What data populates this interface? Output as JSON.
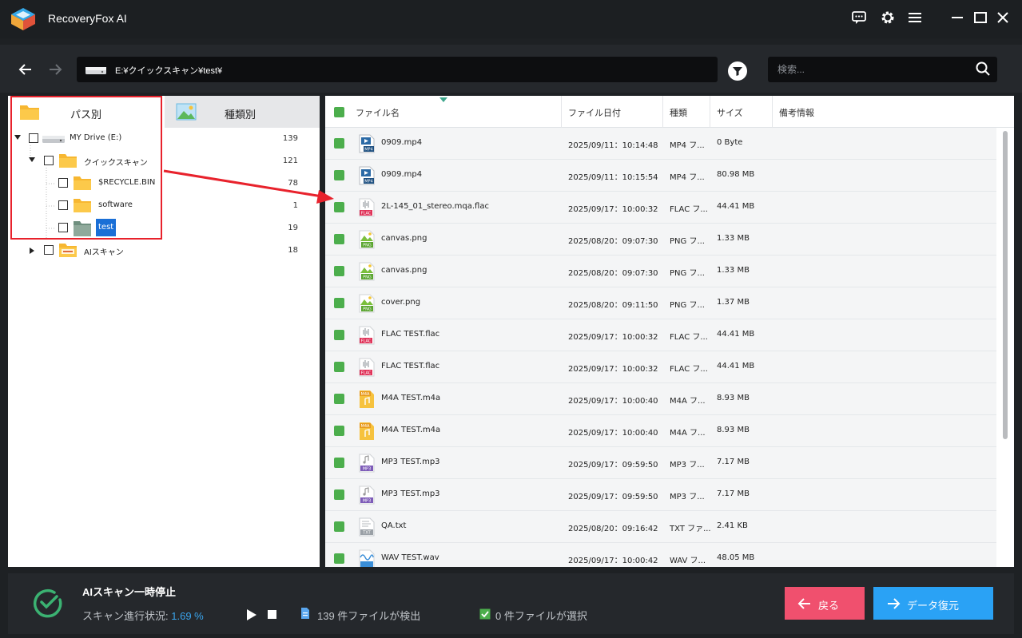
{
  "app": {
    "title": "RecoveryFox AI"
  },
  "address": {
    "path": "E:¥クイックスキャン¥test¥",
    "search_placeholder": "検索..."
  },
  "left": {
    "tabs": [
      {
        "label": "パス別"
      },
      {
        "label": "種類別"
      }
    ],
    "tree": [
      {
        "label": "MY Drive (E:)",
        "count": "139"
      },
      {
        "label": "クイックスキャン",
        "count": "121"
      },
      {
        "label": "$RECYCLE.BIN",
        "count": "78"
      },
      {
        "label": "software",
        "count": "1"
      },
      {
        "label": "test",
        "count": "19"
      },
      {
        "label": "AIスキャン",
        "count": "18"
      }
    ]
  },
  "table": {
    "headers": {
      "name": "ファイル名",
      "date": "ファイル日付",
      "type": "種類",
      "size": "サイズ",
      "note": "備考情報"
    },
    "rows": [
      {
        "name": "0909.mp4",
        "date": "2025/09/11：10:14:48",
        "type": "MP4 フ...",
        "size": "0 Byte",
        "icon": "mp4-icon"
      },
      {
        "name": "0909.mp4",
        "date": "2025/09/11：10:15:54",
        "type": "MP4 フ...",
        "size": "80.98 MB",
        "icon": "mp4-icon"
      },
      {
        "name": "2L-145_01_stereo.mqa.flac",
        "date": "2025/09/17：10:00:32",
        "type": "FLAC フ...",
        "size": "44.41 MB",
        "icon": "flac-icon"
      },
      {
        "name": "canvas.png",
        "date": "2025/08/20：09:07:30",
        "type": "PNG フ...",
        "size": "1.33 MB",
        "icon": "png-icon"
      },
      {
        "name": "canvas.png",
        "date": "2025/08/20：09:07:30",
        "type": "PNG フ...",
        "size": "1.33 MB",
        "icon": "png-icon"
      },
      {
        "name": "cover.png",
        "date": "2025/08/20：09:11:50",
        "type": "PNG フ...",
        "size": "1.37 MB",
        "icon": "png-icon"
      },
      {
        "name": "FLAC TEST.flac",
        "date": "2025/09/17：10:00:32",
        "type": "FLAC フ...",
        "size": "44.41 MB",
        "icon": "flac-icon"
      },
      {
        "name": "FLAC TEST.flac",
        "date": "2025/09/17：10:00:32",
        "type": "FLAC フ...",
        "size": "44.41 MB",
        "icon": "flac-icon"
      },
      {
        "name": "M4A TEST.m4a",
        "date": "2025/09/17：10:00:40",
        "type": "M4A フ...",
        "size": "8.93 MB",
        "icon": "m4a-icon"
      },
      {
        "name": "M4A TEST.m4a",
        "date": "2025/09/17：10:00:40",
        "type": "M4A フ...",
        "size": "8.93 MB",
        "icon": "m4a-icon"
      },
      {
        "name": "MP3 TEST.mp3",
        "date": "2025/09/17：09:59:50",
        "type": "MP3 フ...",
        "size": "7.17 MB",
        "icon": "mp3-icon"
      },
      {
        "name": "MP3 TEST.mp3",
        "date": "2025/09/17：09:59:50",
        "type": "MP3 フ...",
        "size": "7.17 MB",
        "icon": "mp3-icon"
      },
      {
        "name": "QA.txt",
        "date": "2025/08/20：09:16:42",
        "type": "TXT ファ...",
        "size": "2.41 KB",
        "icon": "txt-icon"
      },
      {
        "name": "WAV TEST.wav",
        "date": "2025/09/17：10:00:42",
        "type": "WAV フ...",
        "size": "48.05 MB",
        "icon": "wav-icon"
      }
    ]
  },
  "bottom": {
    "status_title": "AIスキャン一時停止",
    "progress_label": "スキャン進行状況:",
    "progress_value": "1.69 %",
    "found": "139 件ファイルが検出",
    "selected": "0 件ファイルが選択",
    "back_label": "戻る",
    "recover_label": "データ復元"
  },
  "colors": {
    "accent": "#2aa2f5",
    "back": "#f0506e",
    "check": "#4cae4c",
    "highlight": "#e8222c"
  }
}
